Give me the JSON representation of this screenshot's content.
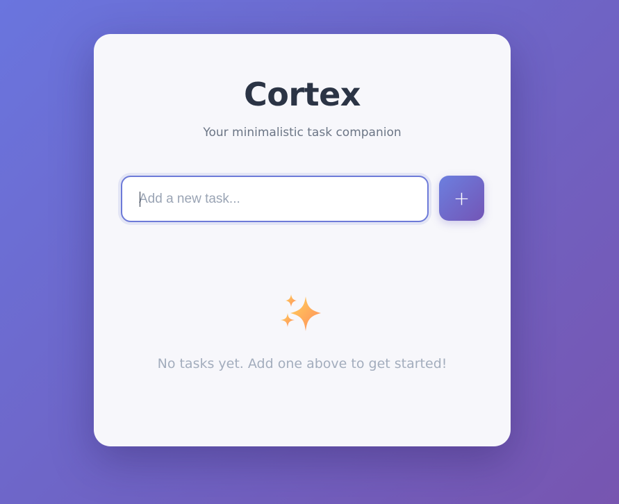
{
  "app": {
    "title": "Cortex",
    "subtitle": "Your minimalistic task companion"
  },
  "task_input": {
    "value": "",
    "placeholder": "Add a new task..."
  },
  "add_button": {
    "label": "+",
    "icon": "plus-icon"
  },
  "empty_state": {
    "icon": "sparkles-icon",
    "message": "No tasks yet. Add one above to get started!"
  },
  "colors": {
    "background_start": "#6a75de",
    "background_end": "#7755b0",
    "card": "#f7f7fb",
    "title": "#2b3445",
    "accent": "#6d7ad8",
    "sparkle": "#ffb347"
  }
}
